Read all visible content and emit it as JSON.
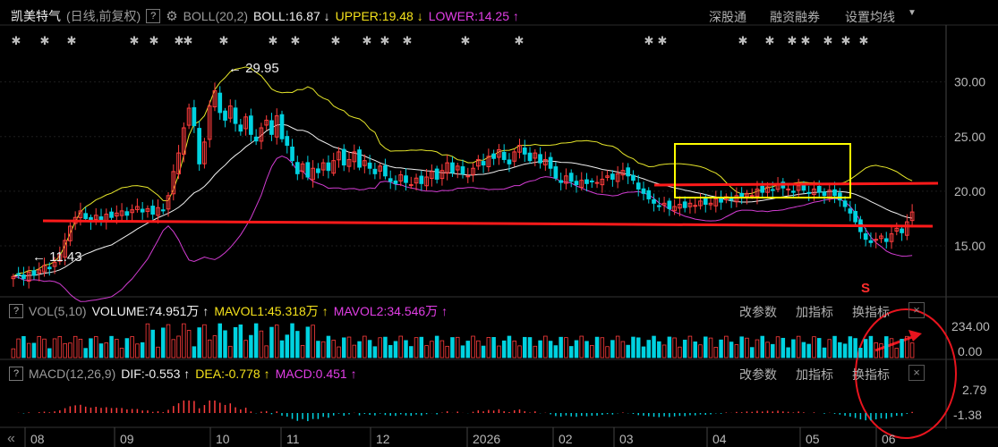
{
  "header": {
    "stock_name": "凯美特气",
    "mode": "(日线,前复权)",
    "help": "?",
    "indicator": "BOLL(20,2)",
    "boll": "BOLL:16.87",
    "boll_arrow": "↓",
    "upper": "UPPER:19.48",
    "upper_arrow": "↓",
    "lower": "LOWER:14.25",
    "lower_arrow": "↑",
    "links": [
      "深股通",
      "融资融券",
      "设置均线"
    ]
  },
  "vol_panel": {
    "help": "?",
    "title": "VOL(5,10)",
    "volume": "VOLUME:74.951万",
    "volume_arrow": "↑",
    "mavol1": "MAVOL1:45.318万",
    "mavol1_arrow": "↑",
    "mavol2": "MAVOL2:34.546万",
    "mavol2_arrow": "↑",
    "tools": [
      "改参数",
      "加指标",
      "换指标"
    ],
    "close": "×",
    "y_ticks": [
      "234.00",
      "0.00"
    ]
  },
  "macd_panel": {
    "help": "?",
    "title": "MACD(12,26,9)",
    "dif": "DIF:-0.553",
    "dif_arrow": "↑",
    "dea": "DEA:-0.778",
    "dea_arrow": "↑",
    "macd": "MACD:0.451",
    "macd_arrow": "↑",
    "tools": [
      "改参数",
      "加指标",
      "换指标"
    ],
    "close": "×",
    "y_ticks": [
      "2.79",
      "-1.38"
    ]
  },
  "colors": {
    "up": "#ff3d3d",
    "down": "#00d2e0",
    "upper": "#e6e62a",
    "mid": "#f0f0f0",
    "lower": "#d23cd2",
    "support_line": "#ff1a1a",
    "box": "#ffff00",
    "annotation": "#e8141e"
  },
  "chart_data": {
    "type": "candlestick",
    "y_ticks": [
      30,
      25,
      20,
      15
    ],
    "y_tick_labels": [
      "30.00",
      "25.00",
      "20.00",
      "15.00"
    ],
    "ylim": [
      10.5,
      33
    ],
    "x_tick_labels": [
      "08",
      "09",
      "10",
      "11",
      "12",
      "2026",
      "02",
      "03",
      "04",
      "05",
      "06"
    ],
    "annotations": {
      "high_label": "29.95",
      "low_label": "11.43",
      "signal": "S"
    },
    "close": [
      12.2,
      12.4,
      12.0,
      12.6,
      12.3,
      12.8,
      13.2,
      12.9,
      13.5,
      14.2,
      15.5,
      16.8,
      17.6,
      18.2,
      17.5,
      17.2,
      17.8,
      17.4,
      17.9,
      17.6,
      18.0,
      18.2,
      17.8,
      18.3,
      18.6,
      18.1,
      18.4,
      17.9,
      18.5,
      18.2,
      19.6,
      21.8,
      23.5,
      25.8,
      27.6,
      26.0,
      22.5,
      24.5,
      27.8,
      29.2,
      27.2,
      26.5,
      27.8,
      26.2,
      25.5,
      26.8,
      25.2,
      24.6,
      25.8,
      26.5,
      25.2,
      26.9,
      24.8,
      24.2,
      22.8,
      21.6,
      22.5,
      21.3,
      22.1,
      21.7,
      22.6,
      21.9,
      22.8,
      23.6,
      22.4,
      22.9,
      23.6,
      22.2,
      22.8,
      22.1,
      21.6,
      22.3,
      21.4,
      20.9,
      20.7,
      21.5,
      20.8,
      20.6,
      21.2,
      20.7,
      21.3,
      21.8,
      21.1,
      21.9,
      22.6,
      21.7,
      22.3,
      21.6,
      21.4,
      22.1,
      22.9,
      22.4,
      23.2,
      23.0,
      23.8,
      22.9,
      22.5,
      23.6,
      24.2,
      23.4,
      22.8,
      23.5,
      22.6,
      22.9,
      22.1,
      21.2,
      20.8,
      21.4,
      20.9,
      20.6,
      21.0,
      20.7,
      20.9,
      20.8,
      21.1,
      21.4,
      21.1,
      21.6,
      21.9,
      21.4,
      21.0,
      20.2,
      19.8,
      19.3,
      18.9,
      18.6,
      18.9,
      18.4,
      18.6,
      18.8,
      18.5,
      18.9,
      18.7,
      19.1,
      18.8,
      18.9,
      19.3,
      19.0,
      19.5,
      19.2,
      19.6,
      19.4,
      19.8,
      19.6,
      20.2,
      19.9,
      20.4,
      20.1,
      20.6,
      20.3,
      20.2,
      19.9,
      20.5,
      20.1,
      19.8,
      20.2,
      19.9,
      19.6,
      20.1,
      19.6,
      19.2,
      18.6,
      18.0,
      17.2,
      16.3,
      15.6,
      15.3,
      15.6,
      15.9,
      15.4,
      16.1,
      16.6,
      16.2,
      17.2,
      18.1
    ]
  }
}
